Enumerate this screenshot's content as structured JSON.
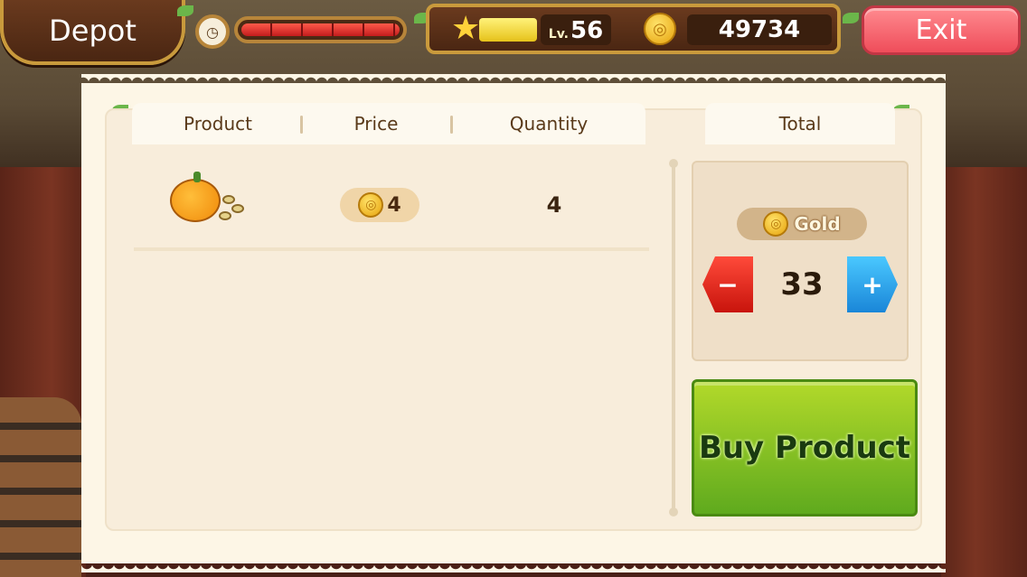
{
  "hud": {
    "title": "Depot",
    "level_prefix": "Lv.",
    "level": "56",
    "gold": "49734",
    "exit_label": "Exit",
    "energy_fill": 1.0,
    "xp_fill": 0.7
  },
  "table": {
    "columns": [
      "Product",
      "Price",
      "Quantity",
      "Total"
    ],
    "rows": [
      {
        "product_icon": "pumpkin-seeds-icon",
        "price": "4",
        "quantity": "4"
      }
    ]
  },
  "total_panel": {
    "currency_label": "Gold",
    "amount": "33",
    "buy_label": "Buy Product"
  },
  "colors": {
    "exit_button": "#ef4d5a",
    "buy_button": "#7fc021",
    "minus_button": "#e0281c",
    "plus_button": "#2aa4ec"
  }
}
